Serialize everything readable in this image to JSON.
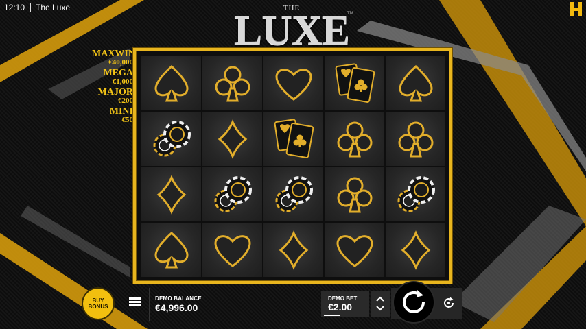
{
  "status_bar": {
    "time": "12:10",
    "title": "The Luxe"
  },
  "logo": {
    "small": "THE",
    "main": "LUXE",
    "tm": "TM"
  },
  "jackpots": [
    {
      "name": "MAXWIN",
      "value": "€40,000"
    },
    {
      "name": "MEGA",
      "value": "€1,000"
    },
    {
      "name": "MAJOR",
      "value": "€200"
    },
    {
      "name": "MINI",
      "value": "€50"
    }
  ],
  "reels": [
    [
      "spade",
      "chips",
      "diamond",
      "spade"
    ],
    [
      "club",
      "diamond",
      "chips",
      "heart"
    ],
    [
      "heart",
      "cards",
      "chips",
      "diamond"
    ],
    [
      "cards",
      "club",
      "club",
      "heart"
    ],
    [
      "spade",
      "club",
      "chips",
      "diamond"
    ]
  ],
  "controls": {
    "buy_bonus_line1": "BUY",
    "buy_bonus_line2": "BONUS",
    "balance_label": "DEMO BALANCE",
    "balance_value": "€4,996.00",
    "bet_label": "DEMO BET",
    "bet_value": "€2.00"
  },
  "colors": {
    "gold": "#f2c316",
    "frame": "#e8b51e",
    "dark": "#0e0e0e"
  }
}
